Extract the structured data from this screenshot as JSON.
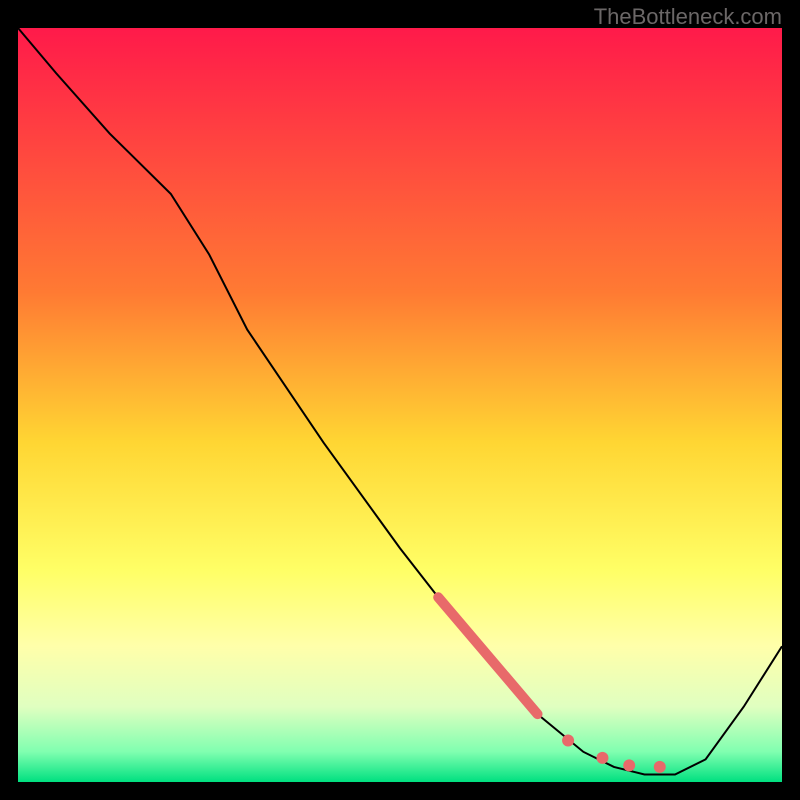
{
  "watermark": "TheBottleneck.com",
  "chart_data": {
    "type": "line",
    "title": "",
    "xlabel": "",
    "ylabel": "",
    "xlim": [
      0,
      100
    ],
    "ylim": [
      0,
      100
    ],
    "background_gradient": {
      "direction": "vertical",
      "stops": [
        {
          "pos": 0.0,
          "color": "#ff1a4a"
        },
        {
          "pos": 0.35,
          "color": "#ff7a33"
        },
        {
          "pos": 0.55,
          "color": "#ffd633"
        },
        {
          "pos": 0.72,
          "color": "#ffff66"
        },
        {
          "pos": 0.82,
          "color": "#ffffaa"
        },
        {
          "pos": 0.9,
          "color": "#e0ffc0"
        },
        {
          "pos": 0.96,
          "color": "#80ffb0"
        },
        {
          "pos": 1.0,
          "color": "#00e080"
        }
      ]
    },
    "series": [
      {
        "name": "curve",
        "type": "line",
        "color": "#000000",
        "stroke_width": 2,
        "x": [
          0,
          5,
          12,
          20,
          25,
          30,
          40,
          50,
          60,
          68,
          74,
          78,
          82,
          86,
          90,
          95,
          100
        ],
        "y": [
          100,
          94,
          86,
          78,
          70,
          60,
          45,
          31,
          18,
          9,
          4,
          2,
          1,
          1,
          3,
          10,
          18
        ]
      },
      {
        "name": "highlight-segment",
        "type": "line",
        "color": "#e86a6a",
        "stroke_width": 10,
        "linecap": "round",
        "x": [
          55,
          68
        ],
        "y": [
          24.5,
          9
        ]
      },
      {
        "name": "dots",
        "type": "scatter",
        "color": "#e86a6a",
        "radius": 6,
        "x": [
          72,
          76.5,
          80,
          84
        ],
        "y": [
          5.5,
          3.2,
          2.2,
          2.0
        ]
      }
    ]
  }
}
